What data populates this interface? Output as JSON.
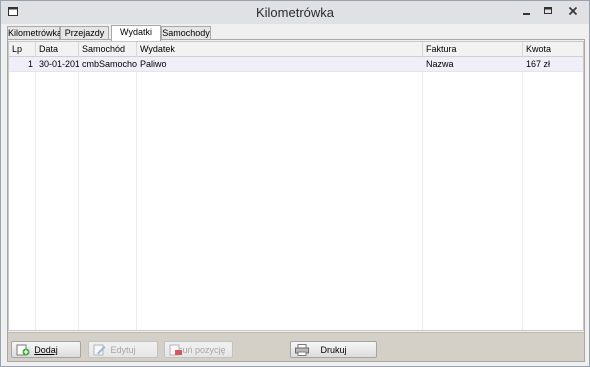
{
  "window": {
    "title": "Kilometrówka"
  },
  "tabs": [
    {
      "label": "Kilometrówka"
    },
    {
      "label": "Przejazdy"
    },
    {
      "label": "Wydatki"
    },
    {
      "label": "Samochody"
    }
  ],
  "active_tab": "Wydatki",
  "table": {
    "columns": [
      "Lp",
      "Data",
      "Samochód",
      "Wydatek",
      "Faktura",
      "Kwota"
    ],
    "rows": [
      {
        "lp": "1",
        "data": "30-01-201",
        "samochod": "cmbSamochod",
        "wydatek": "Paliwo",
        "faktura": "Nazwa",
        "kwota": "167 zł"
      }
    ]
  },
  "buttons": {
    "add": {
      "label": "Dodaj",
      "enabled": true
    },
    "edit": {
      "label": "Edytuj",
      "enabled": false
    },
    "delete": {
      "label": "Usuń pozycję",
      "enabled": false
    },
    "print": {
      "label": "Drukuj",
      "enabled": true
    }
  },
  "icons": [
    "app-icon",
    "minimize-icon",
    "maximize-icon",
    "close-icon",
    "add-icon",
    "edit-icon",
    "delete-icon",
    "print-icon"
  ]
}
